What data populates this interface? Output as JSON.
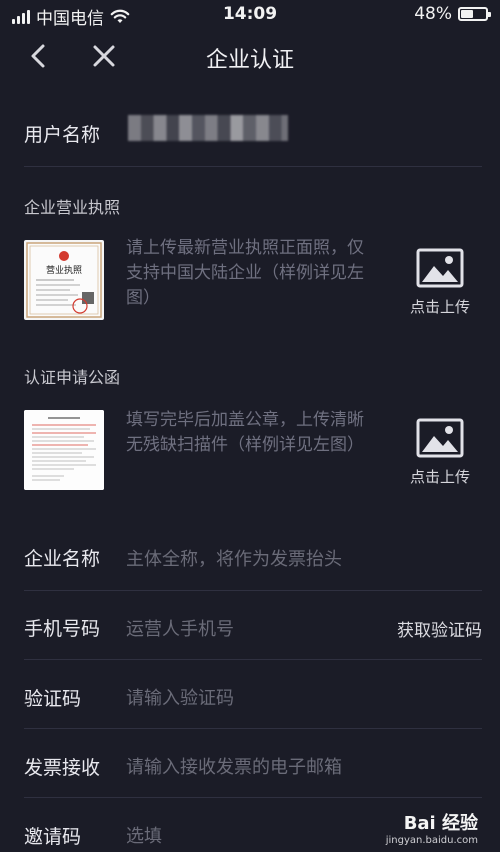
{
  "status_bar": {
    "carrier": "中国电信",
    "time": "14:09",
    "battery_text": "48%",
    "battery_level": 0.48
  },
  "nav": {
    "title": "企业认证"
  },
  "user": {
    "label": "用户名称"
  },
  "license": {
    "section_title": "企业营业执照",
    "thumb_title": "营业执照",
    "description": "请上传最新营业执照正面照，仅支持中国大陆企业（样例详见左图）",
    "upload_label": "点击上传"
  },
  "letter": {
    "section_title": "认证申请公函",
    "description": "填写完毕后加盖公章，上传清晰无残缺扫描件（样例详见左图）",
    "upload_label": "点击上传"
  },
  "form": {
    "company_name": {
      "label": "企业名称",
      "placeholder": "主体全称，将作为发票抬头"
    },
    "phone": {
      "label": "手机号码",
      "placeholder": "运营人手机号",
      "action": "获取验证码"
    },
    "code": {
      "label": "验证码",
      "placeholder": "请输入验证码"
    },
    "invoice": {
      "label": "发票接收",
      "placeholder": "请输入接收发票的电子邮箱"
    },
    "invite": {
      "label": "邀请码",
      "placeholder": "选填"
    }
  },
  "watermark": {
    "brand": "Bai 经验",
    "url": "jingyan.baidu.com"
  },
  "colors": {
    "background": "#1b1c27",
    "placeholder": "#6a6b78",
    "divider": "#2f3040"
  }
}
